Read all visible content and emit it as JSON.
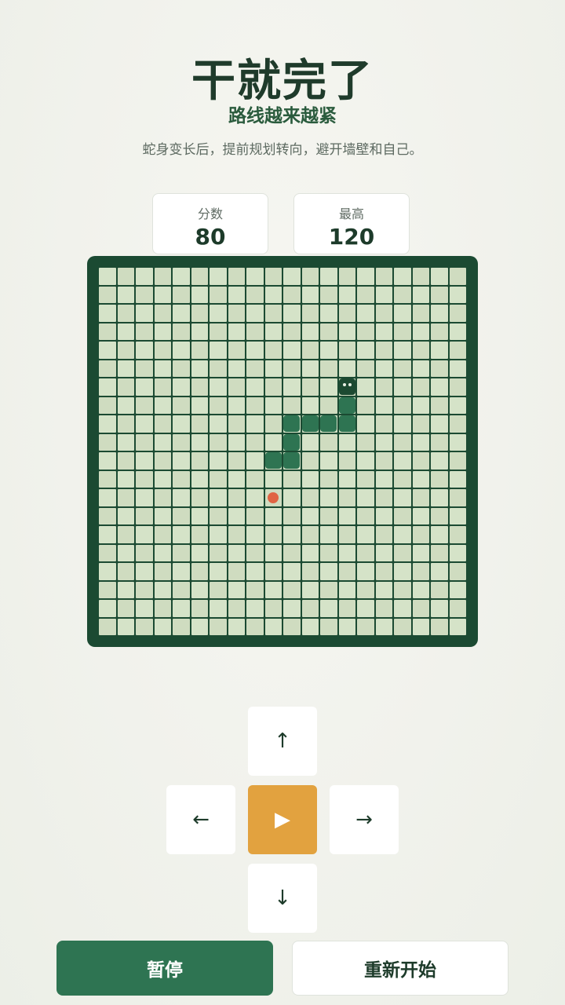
{
  "header": {
    "title": "干就完了",
    "subtitle": "路线越来越紧",
    "hint": "蛇身变长后，提前规划转向，避开墙壁和自己。"
  },
  "scores": {
    "score_label": "分数",
    "score_value": "80",
    "best_label": "最高",
    "best_value": "120"
  },
  "board": {
    "cols": 20,
    "rows": 20,
    "snake": [
      [
        13,
        6
      ],
      [
        13,
        7
      ],
      [
        13,
        8
      ],
      [
        12,
        8
      ],
      [
        11,
        8
      ],
      [
        10,
        8
      ],
      [
        10,
        9
      ],
      [
        10,
        10
      ],
      [
        9,
        10
      ]
    ],
    "food": [
      9,
      12
    ]
  },
  "controls": {
    "up_icon": "↑",
    "left_icon": "←",
    "play_icon": "▶",
    "right_icon": "→",
    "down_icon": "↓",
    "pause_label": "暂停",
    "restart_label": "重新开始"
  },
  "colors": {
    "board_frame": "#1b4a32",
    "snake_body": "#2e7452",
    "snake_head": "#1c4a31",
    "food": "#e06444",
    "accent": "#e2a23f"
  }
}
